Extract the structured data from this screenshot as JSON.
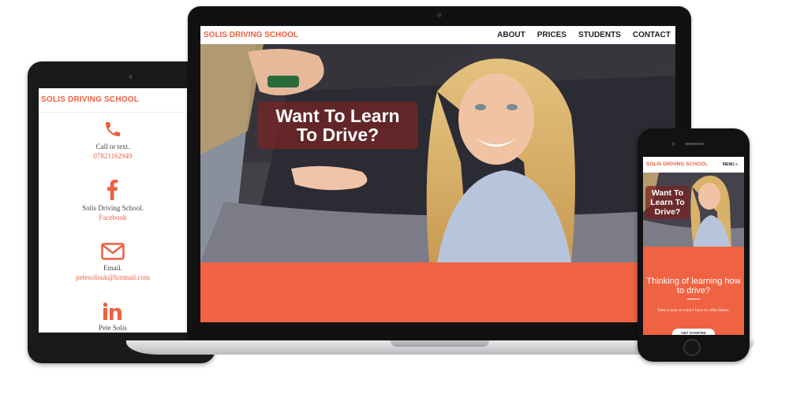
{
  "tablet": {
    "brand": "SOLIS DRIVING SCHOOL",
    "contacts": [
      {
        "icon": "phone-icon",
        "label": "Call or text.",
        "link": "07821162949"
      },
      {
        "icon": "facebook-icon",
        "label": "Solis Driving School.",
        "link": "Facebook"
      },
      {
        "icon": "email-icon",
        "label": "Email.",
        "link": "petesolisuk@hotmail.com"
      },
      {
        "icon": "linkedin-icon",
        "label": "Pete Solis",
        "link": ""
      }
    ]
  },
  "laptop": {
    "brand": "SOLIS DRIVING SCHOOL",
    "nav": [
      "ABOUT",
      "PRICES",
      "STUDENTS",
      "CONTACT"
    ],
    "hero_line1": "Want To Learn",
    "hero_line2": "To Drive?"
  },
  "phone": {
    "brand": "SOLIS DRIVING SCHOOL",
    "menu": "MENU ≡",
    "hero_line1": "Want To",
    "hero_line2": "Learn To",
    "hero_line3": "Drive?",
    "title": "Thinking of learning how to drive?",
    "subtitle": "Take a look at what I have to offer below.",
    "button": "GET STARTED"
  },
  "colors": {
    "accent": "#ef6242",
    "device": "#121212"
  }
}
